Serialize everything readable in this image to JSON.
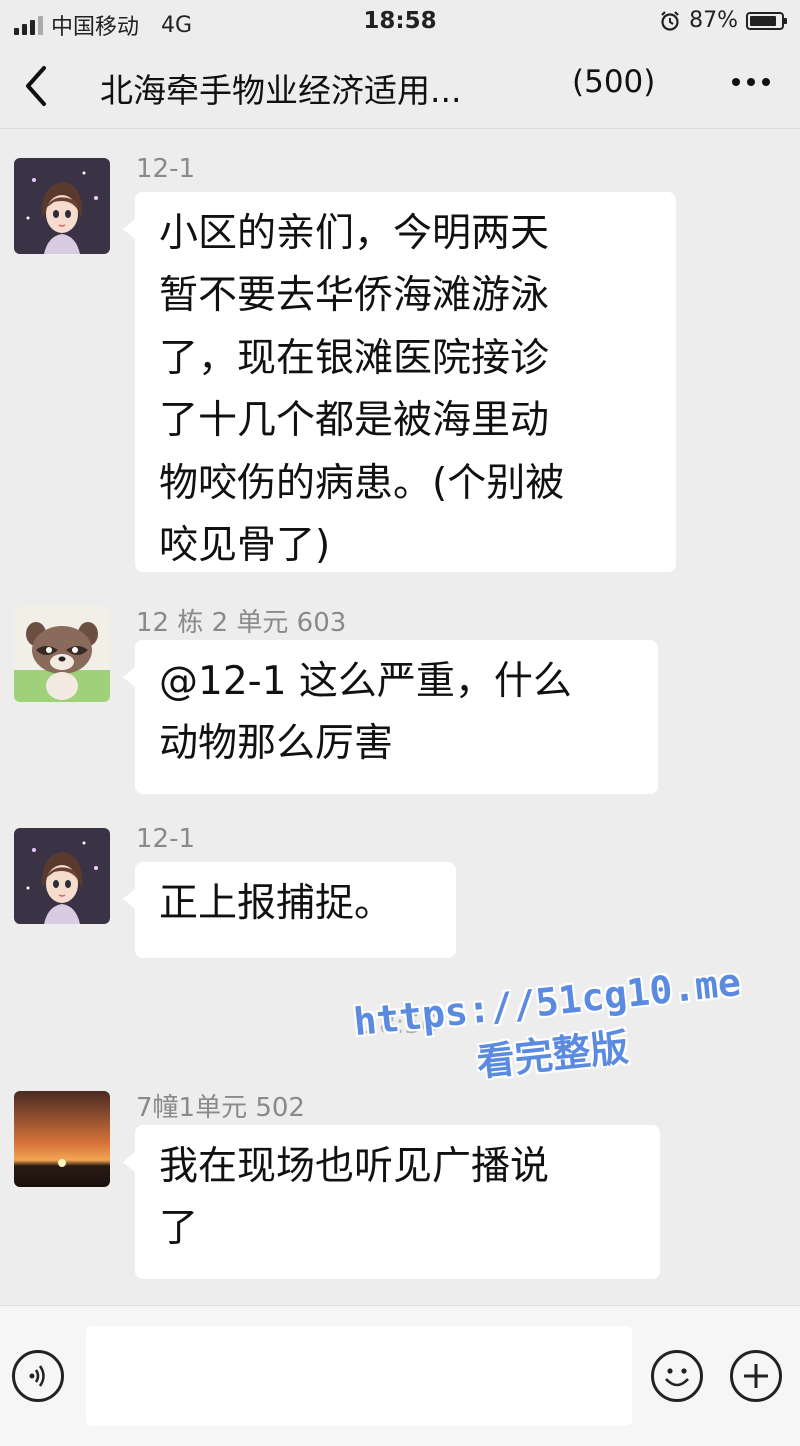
{
  "status_bar": {
    "carrier": "中国移动",
    "network": "4G",
    "time": "18:58",
    "battery_percent": "87%",
    "battery_level": 0.87
  },
  "nav": {
    "title": "北海牵手物业经济适用...",
    "member_count": "(500)"
  },
  "messages": [
    {
      "sender": "12-1",
      "text": "小区的亲们，今明两天\n暂不要去华侨海滩游泳\n了，现在银滩医院接诊\n了十几个都是被海里动\n物咬伤的病患。(个别被\n咬见骨了)",
      "avatar_icon": "girl-avatar-icon"
    },
    {
      "sender": "12 栋 2 单元 603",
      "text": "@12-1 这么严重，什么\n动物那么厉害",
      "avatar_icon": "raccoon-avatar-icon"
    },
    {
      "sender": "12-1",
      "text": "正上报捕捉。",
      "avatar_icon": "girl-avatar-icon"
    },
    {
      "sender": "7幢1单元 502",
      "text": "我在现场也听见广播说\n了",
      "avatar_icon": "sunset-avatar-icon"
    }
  ],
  "timestamp": "18:56",
  "watermark": {
    "line1": "https://51cg10.me",
    "line2": "看完整版"
  },
  "input": {
    "voice_icon": "voice-icon",
    "emoji_icon": "emoji-icon",
    "plus_icon": "plus-icon"
  }
}
